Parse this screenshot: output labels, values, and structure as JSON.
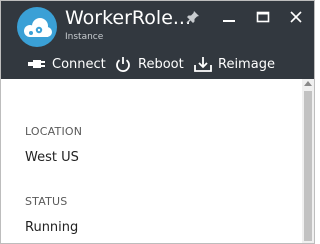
{
  "header": {
    "title": "WorkerRole...",
    "subtitle": "Instance",
    "logo_icon": "cloud-gears-icon",
    "background": "#32383f",
    "window_controls": [
      "pin-icon",
      "minimize-icon",
      "maximize-icon",
      "close-icon"
    ]
  },
  "commands": [
    {
      "label": "Connect",
      "icon": "connect-plug-icon"
    },
    {
      "label": "Reboot",
      "icon": "power-icon"
    },
    {
      "label": "Reimage",
      "icon": "download-tray-icon"
    }
  ],
  "properties": [
    {
      "label": "LOCATION",
      "value": "West US"
    },
    {
      "label": "STATUS",
      "value": "Running"
    }
  ],
  "colors": {
    "header_bg": "#32383f",
    "accent": "#3aa0d6",
    "text": "#222222",
    "label_text": "#5a5a5a"
  }
}
